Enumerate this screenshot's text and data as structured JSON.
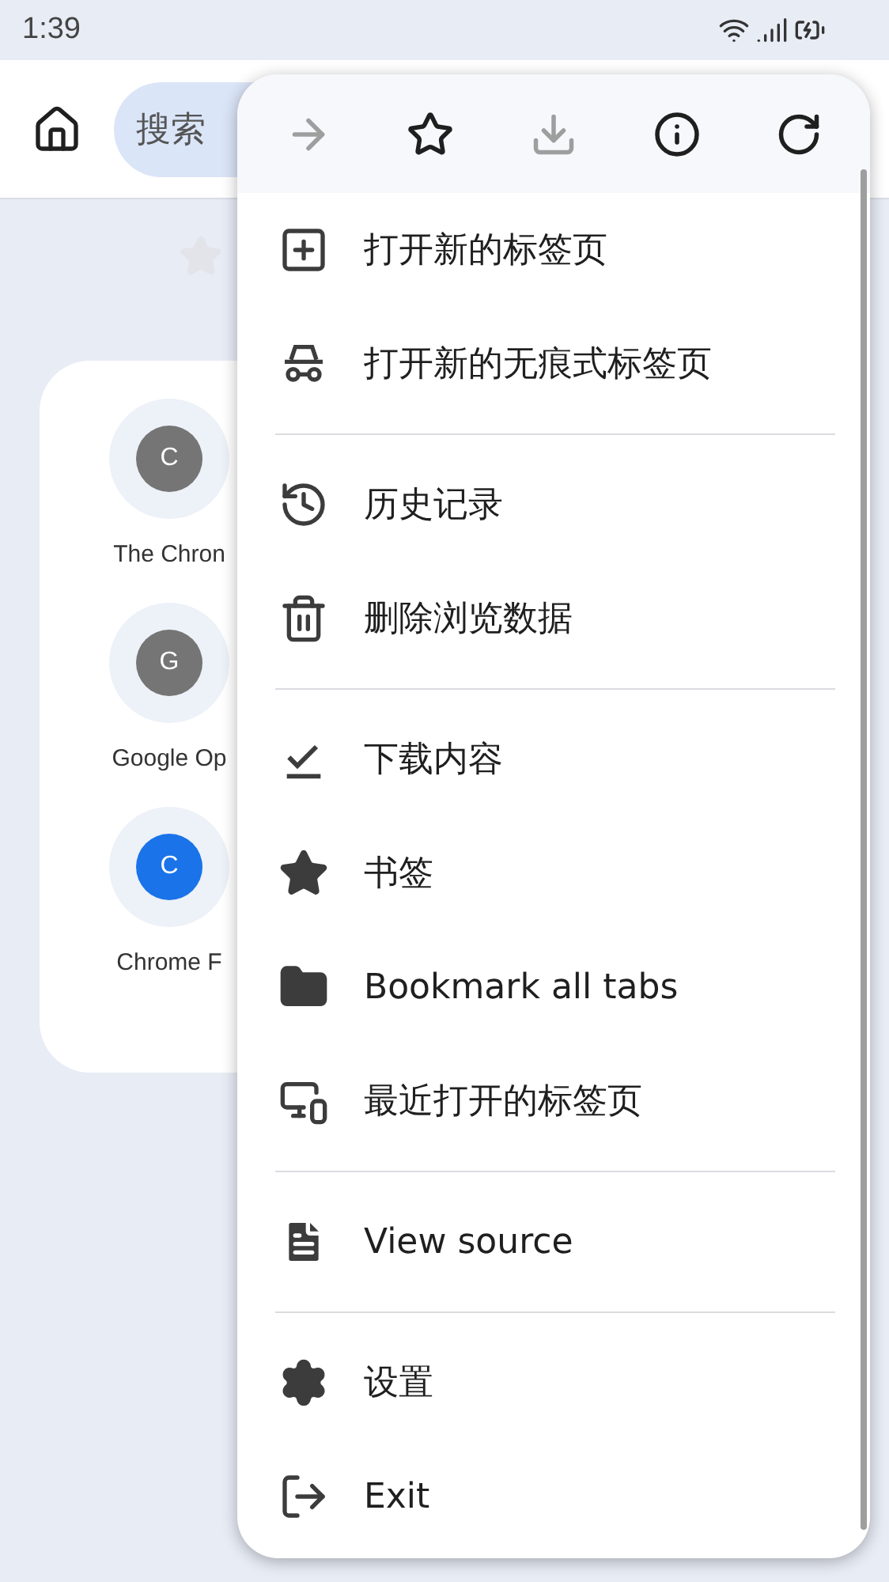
{
  "status_bar": {
    "time": "1:39"
  },
  "toolbar": {
    "search": {
      "placeholder": "搜索"
    }
  },
  "tiles": [
    {
      "letter": "C",
      "color": "#757575",
      "label": "The Chron"
    },
    {
      "letter": "G",
      "color": "#757575",
      "label": "Google Op"
    },
    {
      "letter": "C",
      "color": "#1a73e8",
      "label": "Chrome F"
    }
  ],
  "menu": {
    "actions": [
      {
        "disabled": true
      },
      {
        "disabled": false
      },
      {
        "disabled": true
      },
      {
        "disabled": false
      },
      {
        "disabled": false
      }
    ],
    "sections": [
      [
        {
          "label": "打开新的标签页"
        },
        {
          "label": "打开新的无痕式标签页"
        }
      ],
      [
        {
          "label": "历史记录"
        },
        {
          "label": "删除浏览数据"
        }
      ],
      [
        {
          "label": "下载内容"
        },
        {
          "label": "书签"
        },
        {
          "label": "Bookmark all tabs"
        },
        {
          "label": "最近打开的标签页"
        }
      ],
      [
        {
          "label": "View source"
        }
      ],
      [
        {
          "label": "设置"
        },
        {
          "label": "Exit"
        }
      ]
    ]
  }
}
